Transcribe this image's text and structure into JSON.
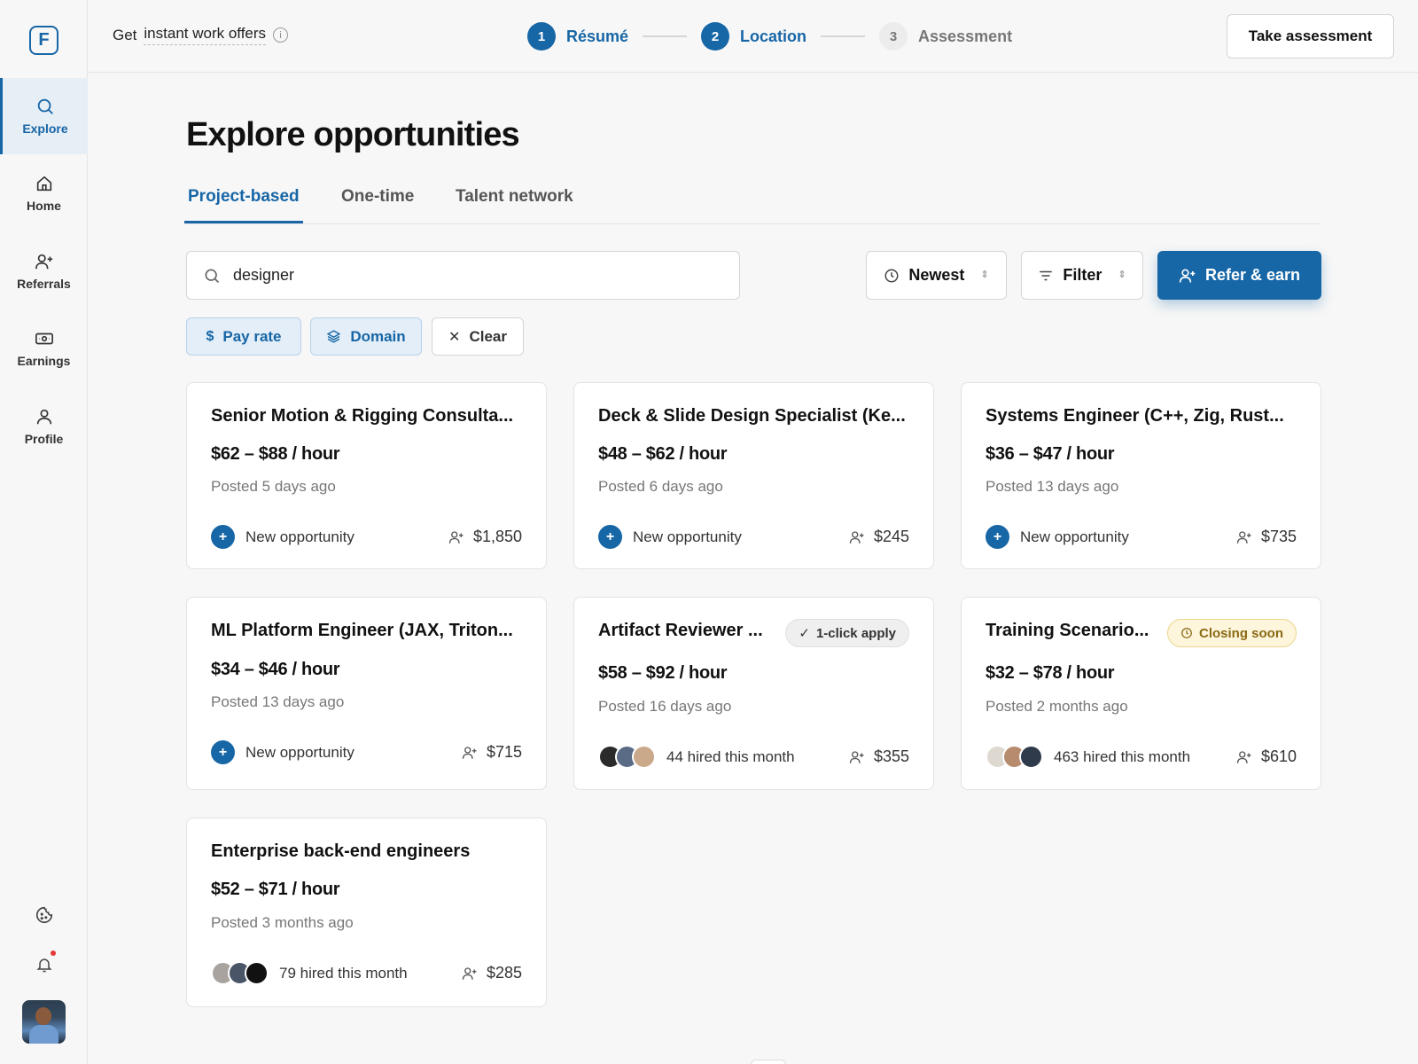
{
  "logo": "F",
  "nav": [
    {
      "label": "Explore",
      "icon": "search-icon"
    },
    {
      "label": "Home",
      "icon": "home-icon"
    },
    {
      "label": "Referrals",
      "icon": "user-plus-icon"
    },
    {
      "label": "Earnings",
      "icon": "money-icon"
    },
    {
      "label": "Profile",
      "icon": "user-icon"
    }
  ],
  "topbar": {
    "promo_prefix": "Get",
    "promo_link": "instant work offers",
    "info": "i",
    "steps": [
      {
        "num": "1",
        "label": "Résumé",
        "state": "done"
      },
      {
        "num": "2",
        "label": "Location",
        "state": "done"
      },
      {
        "num": "3",
        "label": "Assessment",
        "state": "todo"
      }
    ],
    "cta": "Take assessment"
  },
  "main": {
    "title": "Explore opportunities",
    "tabs": [
      "Project-based",
      "One-time",
      "Talent network"
    ],
    "search_value": "designer",
    "sort_label": "Newest",
    "filter_label": "Filter",
    "refer_label": "Refer & earn",
    "chips": [
      "Pay rate",
      "Domain",
      "Clear"
    ]
  },
  "cards": [
    {
      "title": "Senior Motion & Rigging Consulta...",
      "rate": "$62 – $88 / hour",
      "posted": "Posted 5 days ago",
      "foot": "New opportunity",
      "referral": "$1,850"
    },
    {
      "title": "Deck & Slide Design Specialist (Ke...",
      "rate": "$48 – $62 / hour",
      "posted": "Posted 6 days ago",
      "foot": "New opportunity",
      "referral": "$245"
    },
    {
      "title": "Systems Engineer (C++, Zig, Rust...",
      "rate": "$36 – $47 / hour",
      "posted": "Posted 13 days ago",
      "foot": "New opportunity",
      "referral": "$735"
    },
    {
      "title": "ML Platform Engineer (JAX, Triton...",
      "rate": "$34 – $46 / hour",
      "posted": "Posted 13 days ago",
      "foot": "New opportunity",
      "referral": "$715"
    },
    {
      "title": "Artifact Reviewer ...",
      "badge": "1-click apply",
      "rate": "$58 – $92 / hour",
      "posted": "Posted 16 days ago",
      "foot": "44 hired this month",
      "referral": "$355"
    },
    {
      "title": "Training Scenario...",
      "badge": "Closing soon",
      "rate": "$32 – $78 / hour",
      "posted": "Posted 2 months ago",
      "foot": "463 hired this month",
      "referral": "$610"
    },
    {
      "title": "Enterprise back-end engineers",
      "rate": "$52 – $71 / hour",
      "posted": "Posted 3 months ago",
      "foot": "79 hired this month",
      "referral": "$285"
    }
  ],
  "colors": {
    "accent": "#1766a6",
    "warning": "#8a6a14",
    "notification": "#e53935"
  }
}
